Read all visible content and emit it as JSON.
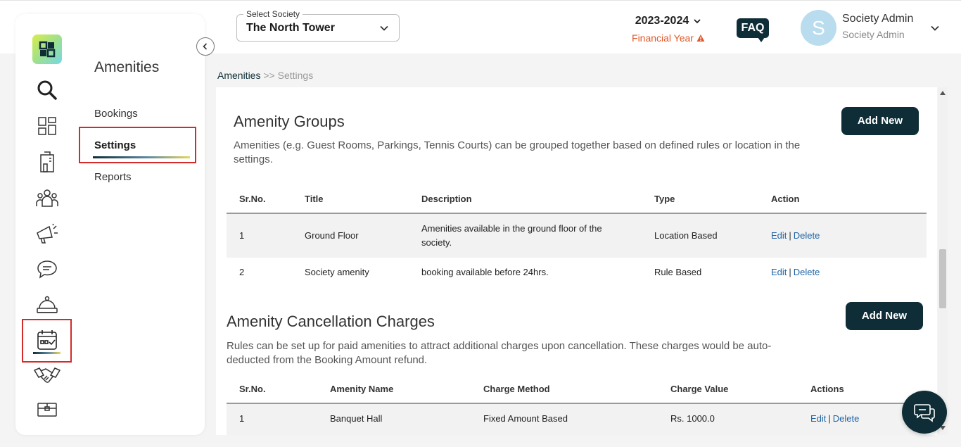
{
  "topbar": {
    "society_select": {
      "legend": "Select Society",
      "value": "The North Tower"
    },
    "financial_year": {
      "year": "2023-2024",
      "label": "Financial Year"
    },
    "faq_label": "FAQ",
    "user": {
      "initial": "S",
      "name": "Society Admin",
      "role": "Society Admin"
    }
  },
  "sidebar": {
    "section_title": "Amenities",
    "items": [
      {
        "label": "Bookings"
      },
      {
        "label": "Settings"
      },
      {
        "label": "Reports"
      }
    ],
    "rail_icons": [
      "search-icon",
      "dashboard-icon",
      "building-icon",
      "people-icon",
      "megaphone-icon",
      "chat-icon",
      "service-bell-icon",
      "calendar-icon",
      "handshake-icon",
      "box-icon"
    ]
  },
  "breadcrumb": {
    "parent": "Amenities",
    "separator": ">>",
    "current": "Settings"
  },
  "amenity_groups": {
    "title": "Amenity Groups",
    "description": "Amenities (e.g. Guest Rooms, Parkings, Tennis Courts) can be grouped together based on defined rules or location in the settings.",
    "add_label": "Add New",
    "columns": [
      "Sr.No.",
      "Title",
      "Description",
      "Type",
      "Action"
    ],
    "rows": [
      {
        "sr": "1",
        "title": "Ground Floor",
        "description": "Amenities available in the ground floor of the society.",
        "type": "Location Based",
        "edit": "Edit",
        "delete": "Delete"
      },
      {
        "sr": "2",
        "title": "Society amenity",
        "description": "booking available before 24hrs.",
        "type": "Rule Based",
        "edit": "Edit",
        "delete": "Delete"
      }
    ]
  },
  "cancellation_charges": {
    "title": "Amenity Cancellation Charges",
    "description": "Rules can be set up for paid amenities to attract additional charges upon cancellation. These charges would be auto-deducted from the Booking Amount refund.",
    "add_label": "Add New",
    "columns": [
      "Sr.No.",
      "Amenity Name",
      "Charge Method",
      "Charge Value",
      "Actions"
    ],
    "rows": [
      {
        "sr": "1",
        "name": "Banquet Hall",
        "method": "Fixed Amount Based",
        "value": "Rs. 1000.0",
        "edit": "Edit",
        "delete": "Delete"
      }
    ]
  },
  "colors": {
    "primary": "#0f2d36",
    "link": "#1e63a6",
    "warning": "#e2582a",
    "highlight": "#d42a2a"
  }
}
